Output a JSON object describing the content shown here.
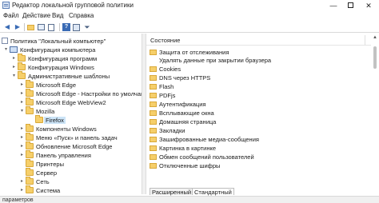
{
  "window": {
    "title": "Редактор локальной групповой политики"
  },
  "menu": {
    "items": [
      "Файл",
      "Действие",
      "Вид",
      "Справка"
    ]
  },
  "toolbar": {
    "buttons": [
      "back-icon",
      "forward-icon",
      "folder-up-icon",
      "show-hide-tree-icon",
      "export-list-icon",
      "help-icon",
      "properties-icon",
      "filter-icon"
    ]
  },
  "tree": {
    "items": [
      {
        "label": "Политика \"Локальный компьютер\"",
        "icon": "doc-icon"
      },
      {
        "label": "Конфигурация компьютера",
        "icon": "pc-icon"
      },
      {
        "label": "Конфигурация программ",
        "icon": "folder-icon"
      },
      {
        "label": "Конфигурация Windows",
        "icon": "folder-icon"
      },
      {
        "label": "Административные шаблоны",
        "icon": "folder-icon"
      },
      {
        "label": "Microsoft Edge",
        "icon": "folder-icon"
      },
      {
        "label": "Microsoft Edge - Настройки по умолчан",
        "icon": "folder-icon"
      },
      {
        "label": "Microsoft Edge WebView2",
        "icon": "folder-icon"
      },
      {
        "label": "Mozilla",
        "icon": "folder-icon"
      },
      {
        "label": "Firefox",
        "icon": "folder-icon"
      },
      {
        "label": "Компоненты Windows",
        "icon": "folder-icon"
      },
      {
        "label": "Меню «Пуск» и панель задач",
        "icon": "folder-icon"
      },
      {
        "label": "Обновление Microsoft Edge",
        "icon": "folder-icon"
      },
      {
        "label": "Панель управления",
        "icon": "folder-icon"
      },
      {
        "label": "Принтеры",
        "icon": "folder-icon"
      },
      {
        "label": "Сервер",
        "icon": "folder-icon"
      },
      {
        "label": "Сеть",
        "icon": "folder-icon"
      },
      {
        "label": "Система",
        "icon": "folder-icon"
      }
    ]
  },
  "list": {
    "column_header": "Состояние",
    "items": [
      "Защита от отслеживания",
      "Удалять данные при закрытии браузера",
      "Cookies",
      "DNS через HTTPS",
      "Flash",
      "PDFjs",
      "Аутентификация",
      "Всплывающие окна",
      "Домашняя страница",
      "Закладки",
      "Зашифрованные медиа-сообщения",
      "Картинка в картинке",
      "Обмен сообщений пользователей",
      "Отключенные шифры"
    ]
  },
  "tabs": {
    "extended": "Расширенный",
    "standard": "Стандартный"
  },
  "status": {
    "text": "параметров"
  }
}
